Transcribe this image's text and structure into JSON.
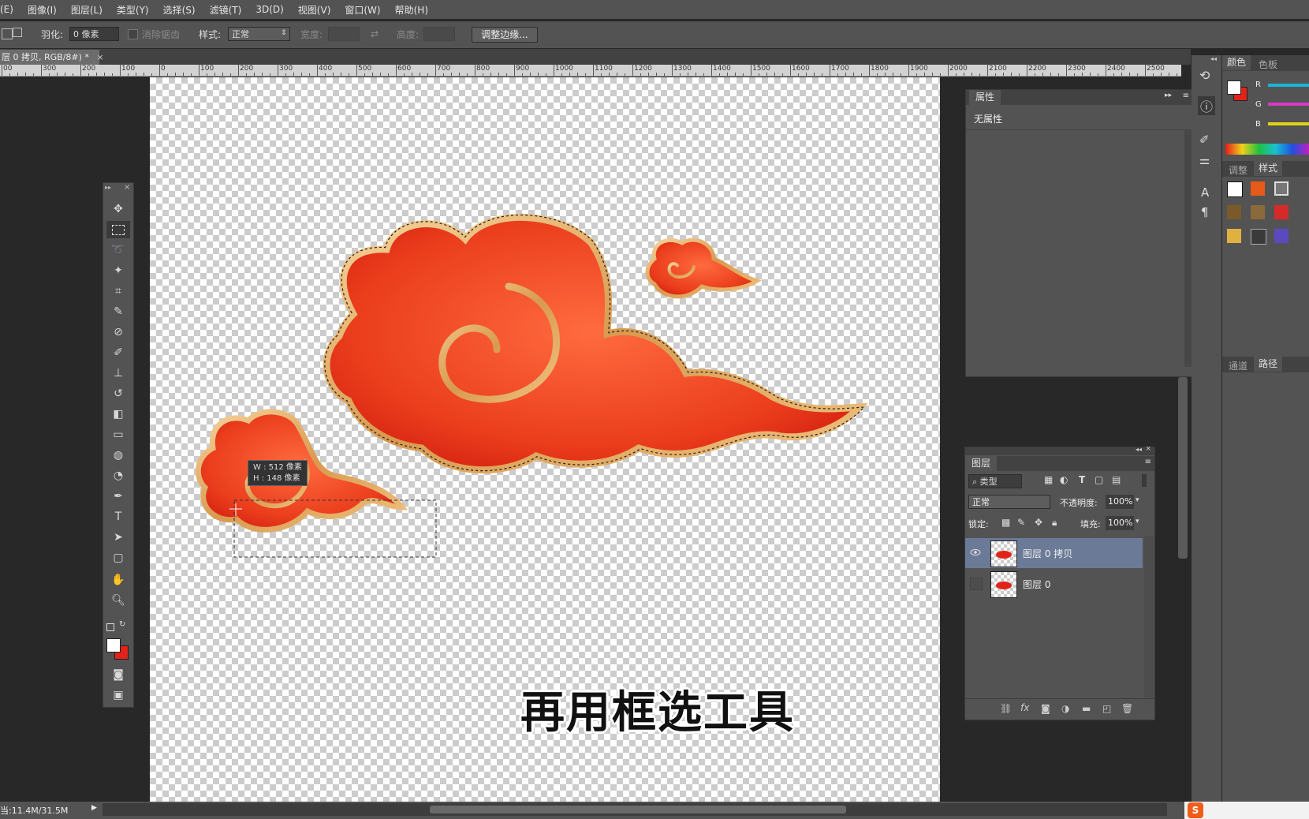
{
  "menu": [
    "(E)",
    "图像(I)",
    "图层(L)",
    "类型(Y)",
    "选择(S)",
    "滤镜(T)",
    "3D(D)",
    "视图(V)",
    "窗口(W)",
    "帮助(H)"
  ],
  "options": {
    "feather_label": "羽化:",
    "feather_value": "0 像素",
    "antialias_label": "消除锯齿",
    "style_label": "样式:",
    "style_value": "正常",
    "width_label": "宽度:",
    "height_label": "高度:",
    "refine_button": "调整边缘..."
  },
  "document": {
    "tab_title": "层 0 拷贝, RGB/8#) *",
    "close": "×"
  },
  "ruler": {
    "labels": [
      "00",
      "300",
      "200",
      "100",
      "0",
      "100",
      "200",
      "300",
      "400",
      "500",
      "600",
      "700",
      "800",
      "900",
      "1000",
      "1100",
      "1200",
      "1300",
      "1400",
      "1500",
      "1600",
      "1700",
      "1800",
      "1900",
      "2000",
      "2100",
      "2200",
      "2300",
      "2400",
      "2500"
    ]
  },
  "tooltip": {
    "w": "W : 512 像素",
    "h": "H : 148 像素"
  },
  "subtitle": "再用框选工具",
  "properties": {
    "tab": "属性",
    "content": "无属性"
  },
  "layers": {
    "tab": "图层",
    "filter": "类型",
    "blend": "正常",
    "opacity_label": "不透明度:",
    "opacity_value": "100%",
    "lock_label": "锁定:",
    "fill_label": "填充:",
    "fill_value": "100%",
    "items": [
      {
        "name": "图层 0 拷贝",
        "selected": true,
        "visible": true
      },
      {
        "name": "图层 0",
        "selected": false,
        "visible": false
      }
    ]
  },
  "right_panels": {
    "color_tabs": [
      "颜色",
      "色板"
    ],
    "channels": [
      "R",
      "G",
      "B"
    ],
    "adjust_tabs": [
      "调整",
      "样式"
    ],
    "bottom_tabs": [
      "通道",
      "路径"
    ]
  },
  "status": {
    "doc_size": "当:11.4M/31.5M"
  },
  "colors": {
    "ui_bg": "#535353",
    "accent_red": "#e2231a",
    "gold": "#e7b66f",
    "selected_layer": "#6b7a97"
  }
}
